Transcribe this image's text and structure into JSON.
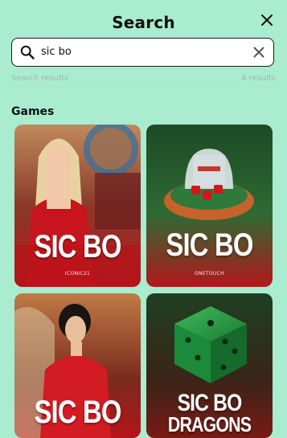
{
  "header": {
    "title": "Search",
    "close_icon": "close-icon"
  },
  "search": {
    "value": "sic bo",
    "placeholder": "",
    "search_icon": "search-icon",
    "clear_icon": "clear-icon"
  },
  "results": {
    "label": "Search results",
    "count": "4 results"
  },
  "section": {
    "title": "Games"
  },
  "games": [
    {
      "title": "SIC BO",
      "subtitle": "ICONIC21"
    },
    {
      "title": "SIC BO",
      "subtitle": "ONETOUCH"
    },
    {
      "title": "SIC BO",
      "subtitle": ""
    },
    {
      "title": "SIC BO",
      "title_line2": "DRAGONS",
      "subtitle": ""
    }
  ],
  "colors": {
    "background": "#a9ecd0",
    "tile_red": "#b3171b",
    "tile_green": "#1f5a2e"
  }
}
